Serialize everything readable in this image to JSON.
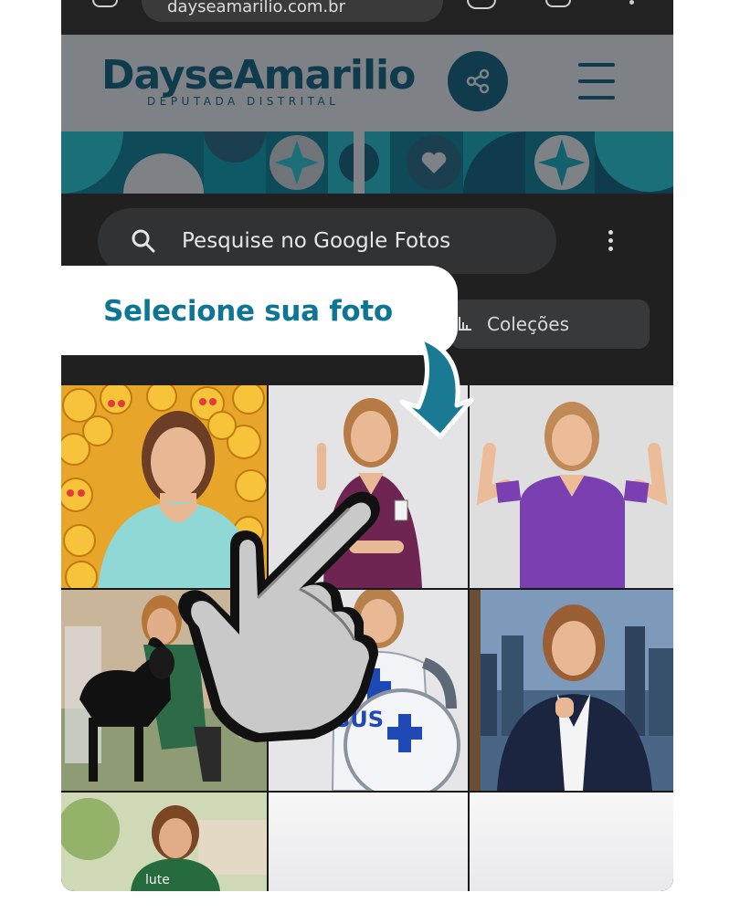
{
  "status_bar": {
    "url_text": "dayseamarilio.com.br"
  },
  "header": {
    "logo_main": "DayseAmarilio",
    "logo_sub": "DEPUTADA DISTRITAL",
    "share_icon": "share-icon",
    "menu_icon": "hamburger-menu-icon",
    "brand_color": "#0f3b4c",
    "accent_color": "#0d7694"
  },
  "photos_app": {
    "search_placeholder": "Pesquise no Google Fotos",
    "collections_label": "Coleções"
  },
  "callout": {
    "text": "Selecione sua foto"
  },
  "grid": {
    "photos": [
      {
        "subject": "woman in light-blue blouse with emoji background"
      },
      {
        "subject": "woman in purple scrubs pointing up"
      },
      {
        "subject": "woman in purple scrubs flexing arms"
      },
      {
        "subject": "woman hugging black dog"
      },
      {
        "subject": "woman in SUS superhero armor with shield"
      },
      {
        "subject": "woman in navy blazer with city background"
      },
      {
        "subject": "woman in green shirt outdoors"
      },
      {
        "subject": "blank"
      },
      {
        "subject": "blank"
      }
    ]
  }
}
